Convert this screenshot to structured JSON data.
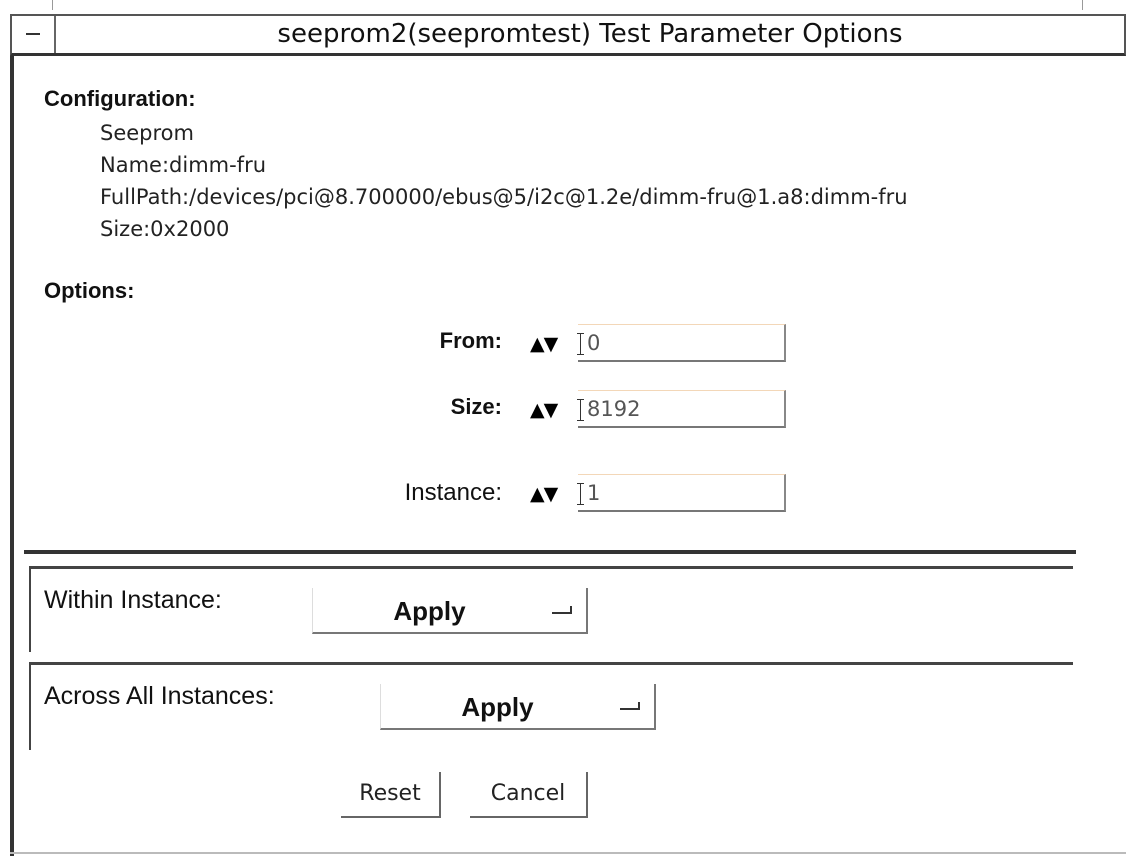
{
  "window": {
    "title": "seeprom2(seepromtest) Test Parameter Options"
  },
  "configuration": {
    "heading": "Configuration:",
    "lines": [
      "Seeprom",
      "Name:dimm-fru",
      "FullPath:/devices/pci@8.700000/ebus@5/i2c@1.2e/dimm-fru@1.a8:dimm-fru",
      "Size:0x2000"
    ]
  },
  "options": {
    "heading": "Options:",
    "spinner_glyph": "▲▼",
    "fields": [
      {
        "label": "From:",
        "value": "0"
      },
      {
        "label": "Size:",
        "value": "8192"
      },
      {
        "label": "Instance:",
        "value": "1"
      }
    ]
  },
  "within_instance": {
    "label": "Within Instance:",
    "menu_value": "Apply"
  },
  "across_all_instances": {
    "label": "Across All Instances:",
    "menu_value": "Apply"
  },
  "buttons": {
    "reset": "Reset",
    "cancel": "Cancel"
  }
}
